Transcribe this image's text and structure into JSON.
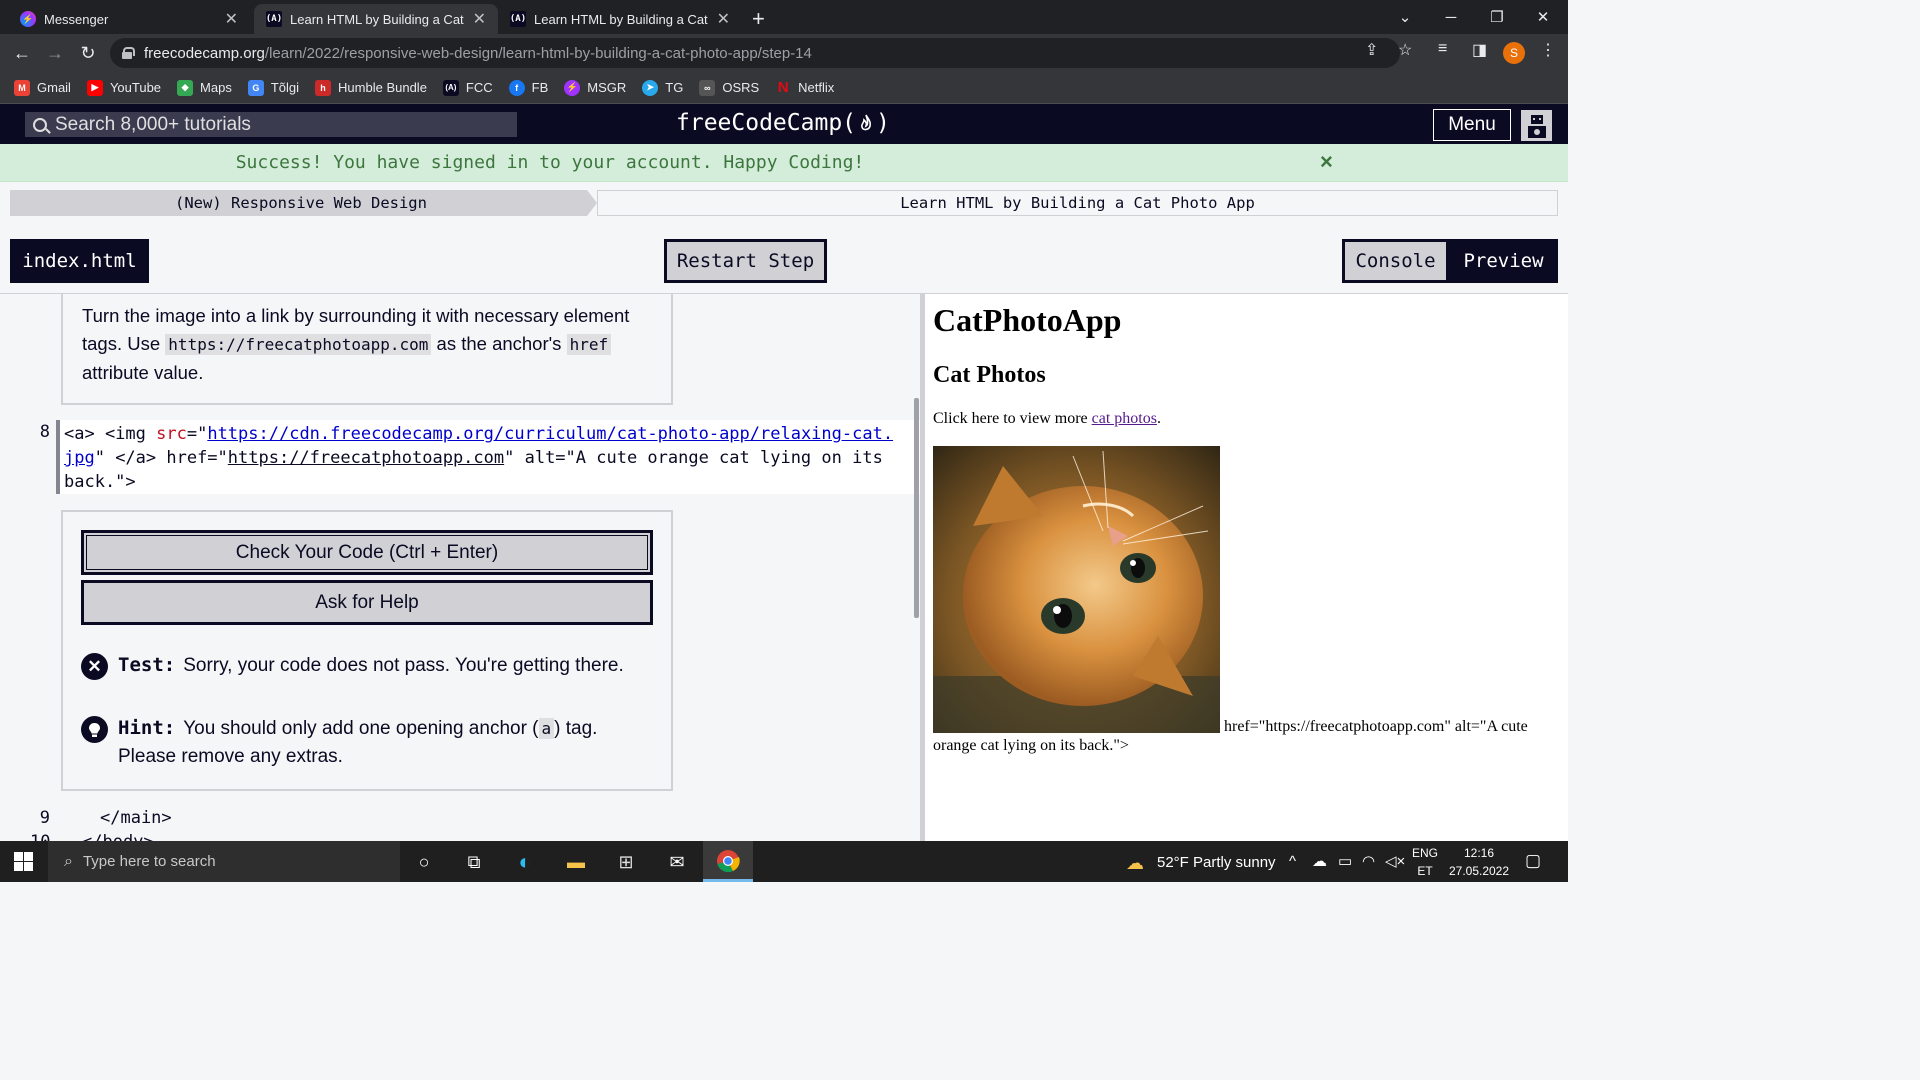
{
  "browser": {
    "tabs": [
      {
        "label": "Messenger",
        "icon": "messenger-icon"
      },
      {
        "label": "Learn HTML by Building a Cat Ph",
        "icon": "fcc-icon",
        "active": true
      },
      {
        "label": "Learn HTML by Building a Cat Ph",
        "icon": "fcc-icon"
      }
    ],
    "new_tab": "+",
    "url_domain": "freecodecamp.org",
    "url_path": "/learn/2022/responsive-web-design/learn-html-by-building-a-cat-photo-app/step-14",
    "profile_initial": "S",
    "bookmarks": [
      {
        "label": "Gmail",
        "icon": "gmail-icon",
        "color": "#ea4335"
      },
      {
        "label": "YouTube",
        "icon": "youtube-icon",
        "color": "#ff0000"
      },
      {
        "label": "Maps",
        "icon": "maps-icon",
        "color": "#34a853"
      },
      {
        "label": "Tõlgi",
        "icon": "translate-icon",
        "color": "#4285f4"
      },
      {
        "label": "Humble Bundle",
        "icon": "humble-bundle-icon",
        "color": "#cc2929"
      },
      {
        "label": "FCC",
        "icon": "fcc-icon",
        "color": "#0a0a23"
      },
      {
        "label": "FB",
        "icon": "facebook-icon",
        "color": "#1877f2"
      },
      {
        "label": "MSGR",
        "icon": "messenger-icon",
        "color": "#a033ff"
      },
      {
        "label": "TG",
        "icon": "telegram-icon",
        "color": "#29a9eb"
      },
      {
        "label": "OSRS",
        "icon": "osrs-icon",
        "color": "#555555"
      },
      {
        "label": "Netflix",
        "icon": "netflix-icon",
        "color": "#e50914"
      }
    ]
  },
  "fcc": {
    "search_placeholder": "Search 8,000+ tutorials",
    "logo_text": "freeCodeCamp",
    "menu_label": "Menu",
    "flash_message": "Success! You have signed in to your account. Happy Coding!",
    "flash_close": "×",
    "breadcrumb": {
      "superblock": "(New) Responsive Web Design",
      "block": "Learn HTML by Building a Cat Photo App"
    },
    "file_tab": "index.html",
    "restart_label": "Restart Step",
    "console_label": "Console",
    "preview_label": "Preview"
  },
  "editor": {
    "description_parts": {
      "p1": "Turn the image into a link by surrounding it with necessary element tags. Use ",
      "code1": "https://freecatphotoapp.com",
      "p2": " as the anchor's ",
      "code2": "href",
      "p3": " attribute value."
    },
    "line8_number": "8",
    "line8": {
      "t1": "<a> <img ",
      "attr1": "src",
      "t2": "=\"",
      "url": "https://cdn.freecodecamp.org/curriculum/cat-photo-app/relaxing-cat.jpg",
      "t3": "\" </a> href=\"",
      "href": "https://freecatphotoapp.com",
      "t4": "\" alt=\"A cute orange cat lying on its back.\">"
    },
    "check_label": "Check Your Code (Ctrl + Enter)",
    "help_label": "Ask for Help",
    "test_label": "Test:",
    "test_text": "Sorry, your code does not pass. You're getting there.",
    "hint_label": "Hint:",
    "hint_parts": {
      "p1": "You should only add one opening anchor (",
      "code": "a",
      "p2": ") tag. Please remove any extras."
    },
    "line9_number": "9",
    "line9": "</main>",
    "line10_number": "10",
    "line10": "</body>"
  },
  "preview": {
    "h1": "CatPhotoApp",
    "h2": "Cat Photos",
    "p_text": "Click here to view more ",
    "p_link": "cat photos",
    "p_end": ".",
    "trailing_text1": "href=\"https://freecatphotoapp.com\" alt=\"A cute",
    "trailing_text2": "orange cat lying on its back.\">"
  },
  "taskbar": {
    "search_placeholder": "Type here to search",
    "weather": "52°F  Partly sunny",
    "lang_top": "ENG",
    "lang_bottom": "ET",
    "time": "12:16",
    "date": "27.05.2022"
  }
}
